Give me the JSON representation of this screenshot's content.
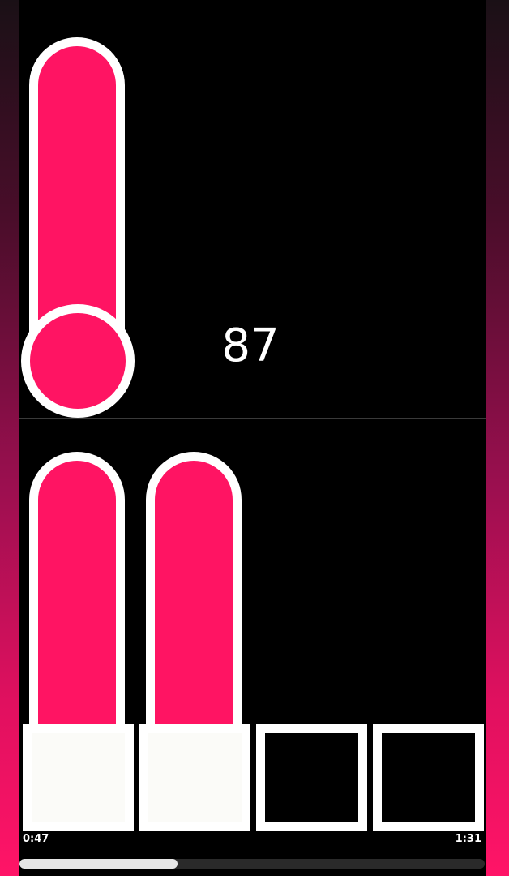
{
  "score": "87",
  "thermometer": {
    "level": 1.0,
    "color": "#ff1463"
  },
  "bars": [
    {
      "level": 1.0,
      "color": "#ff1463"
    },
    {
      "level": 1.0,
      "color": "#ff1463"
    }
  ],
  "slots": [
    {
      "filled": true
    },
    {
      "filled": true
    },
    {
      "filled": false
    },
    {
      "filled": false
    }
  ],
  "player": {
    "elapsed": "0:47",
    "duration": "1:31",
    "progress": 0.34
  }
}
